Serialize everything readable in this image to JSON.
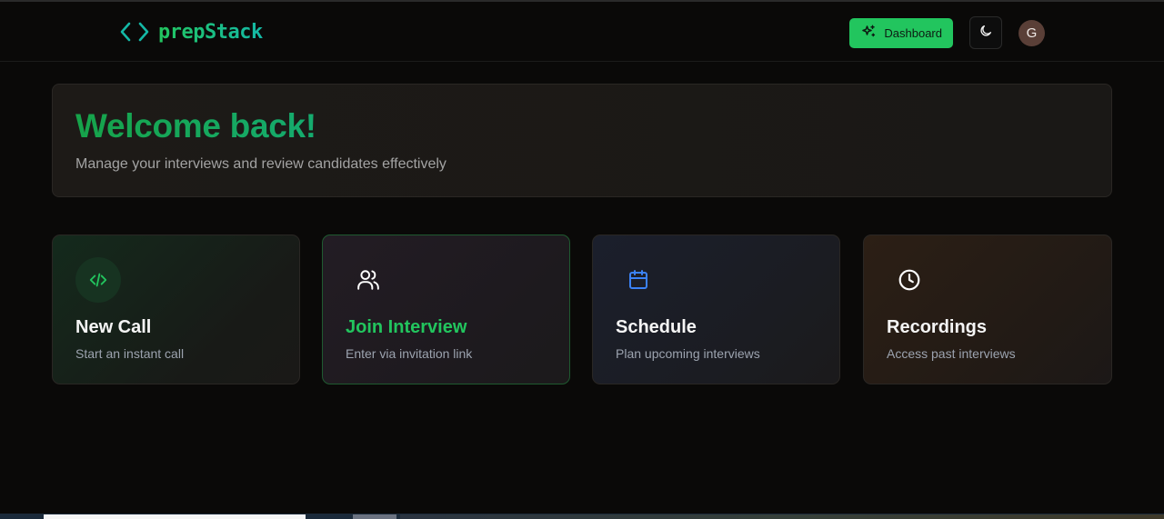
{
  "brand": {
    "name": "prepStack",
    "accent": "#22c55e"
  },
  "header": {
    "dashboard_label": "Dashboard",
    "avatar_initial": "G"
  },
  "welcome": {
    "title": "Welcome back!",
    "subtitle": "Manage your interviews and review candidates effectively"
  },
  "actions": [
    {
      "title": "New Call",
      "description": "Start an instant call",
      "icon": "code-icon",
      "color": "#22c55e"
    },
    {
      "title": "Join Interview",
      "description": "Enter via invitation link",
      "icon": "users-icon",
      "color": "#ffffff"
    },
    {
      "title": "Schedule",
      "description": "Plan upcoming interviews",
      "icon": "calendar-icon",
      "color": "#3b82f6"
    },
    {
      "title": "Recordings",
      "description": "Access past interviews",
      "icon": "clock-icon",
      "color": "#ffffff"
    }
  ]
}
